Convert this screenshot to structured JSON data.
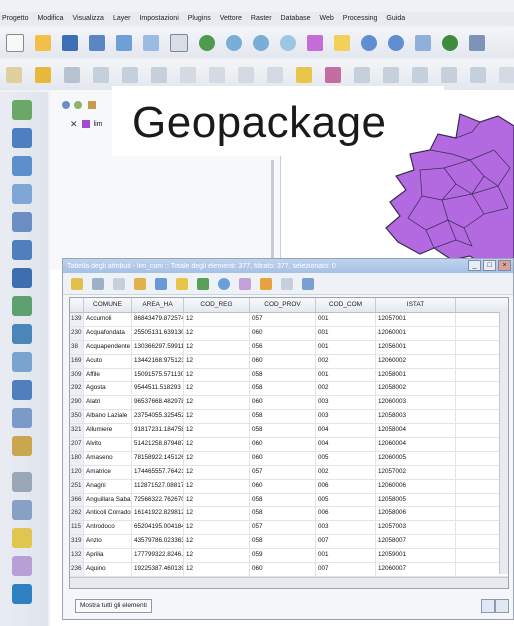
{
  "overlay_title": "Geopackage",
  "menu": [
    "Progetto",
    "Modifica",
    "Visualizza",
    "Layer",
    "Impostazioni",
    "Plugins",
    "Vettore",
    "Raster",
    "Database",
    "Web",
    "Processing",
    "Guida"
  ],
  "layers": {
    "item_label": "lim"
  },
  "attribute_table": {
    "window_title": "Tabella degli attributi - lim_com :: Totale degli elementi: 377, filtrato: 377, selezionato: 0",
    "columns": [
      "COMUNE",
      "AREA_HA",
      "COD_REG",
      "COD_PROV",
      "COD_COM",
      "ISTAT"
    ],
    "rows": [
      [
        "139",
        "Accumoli",
        "86843479.872574",
        "12",
        "057",
        "001",
        "12057001"
      ],
      [
        "230",
        "Acquafondata",
        "25505131.639130",
        "12",
        "060",
        "001",
        "12060001"
      ],
      [
        "38",
        "Acquapendente",
        "130366297.599114",
        "12",
        "056",
        "001",
        "12056001"
      ],
      [
        "169",
        "Acuto",
        "13442168.975123",
        "12",
        "060",
        "002",
        "12060002"
      ],
      [
        "309",
        "Affile",
        "15091575.571130",
        "12",
        "058",
        "001",
        "12058001"
      ],
      [
        "292",
        "Agosta",
        "9544511.518293",
        "12",
        "058",
        "002",
        "12058002"
      ],
      [
        "290",
        "Alatri",
        "96537668.482978",
        "12",
        "060",
        "003",
        "12060003"
      ],
      [
        "350",
        "Albano Laziale",
        "23754055.325452",
        "12",
        "058",
        "003",
        "12058003"
      ],
      [
        "321",
        "Allumiere",
        "91817231.184758",
        "12",
        "058",
        "004",
        "12058004"
      ],
      [
        "207",
        "Alvito",
        "51421258.879487",
        "12",
        "060",
        "004",
        "12060004"
      ],
      [
        "180",
        "Amaseno",
        "78158922.145126",
        "12",
        "060",
        "005",
        "12060005"
      ],
      [
        "120",
        "Amatrice",
        "174465557.764214",
        "12",
        "057",
        "002",
        "12057002"
      ],
      [
        "251",
        "Anagni",
        "112871527.088176",
        "12",
        "060",
        "006",
        "12060006"
      ],
      [
        "366",
        "Anguillara Sabazia",
        "72566322.762670",
        "12",
        "058",
        "005",
        "12058005"
      ],
      [
        "262",
        "Anticoli Corrado",
        "16141922.829812",
        "12",
        "058",
        "006",
        "12058006"
      ],
      [
        "115",
        "Antrodoco",
        "65204195.004184",
        "12",
        "057",
        "003",
        "12057003"
      ],
      [
        "319",
        "Anzio",
        "43579786.023363",
        "12",
        "058",
        "007",
        "12058007"
      ],
      [
        "132",
        "Aprilia",
        "177799322.8246…",
        "12",
        "059",
        "001",
        "12059001"
      ],
      [
        "236",
        "Aquino",
        "19225387.460139",
        "12",
        "060",
        "007",
        "12060007"
      ]
    ],
    "show_all_label": "Mostra tutti gli elementi"
  },
  "colors": {
    "polygon_fill": "#b36ae0",
    "polygon_stroke": "#3a2a55",
    "layer_swatch": "#a04bd6"
  },
  "icons": [
    "new-project-icon",
    "open-project-icon",
    "save-project-icon",
    "save-as-icon",
    "pan-icon",
    "zoom-in-icon",
    "zoom-out-icon",
    "identify-icon",
    "select-icon",
    "table-icon",
    "add-vector-icon",
    "add-raster-icon",
    "edit-icon",
    "digitize-icon",
    "save-edits-icon",
    "node-tool-icon"
  ]
}
